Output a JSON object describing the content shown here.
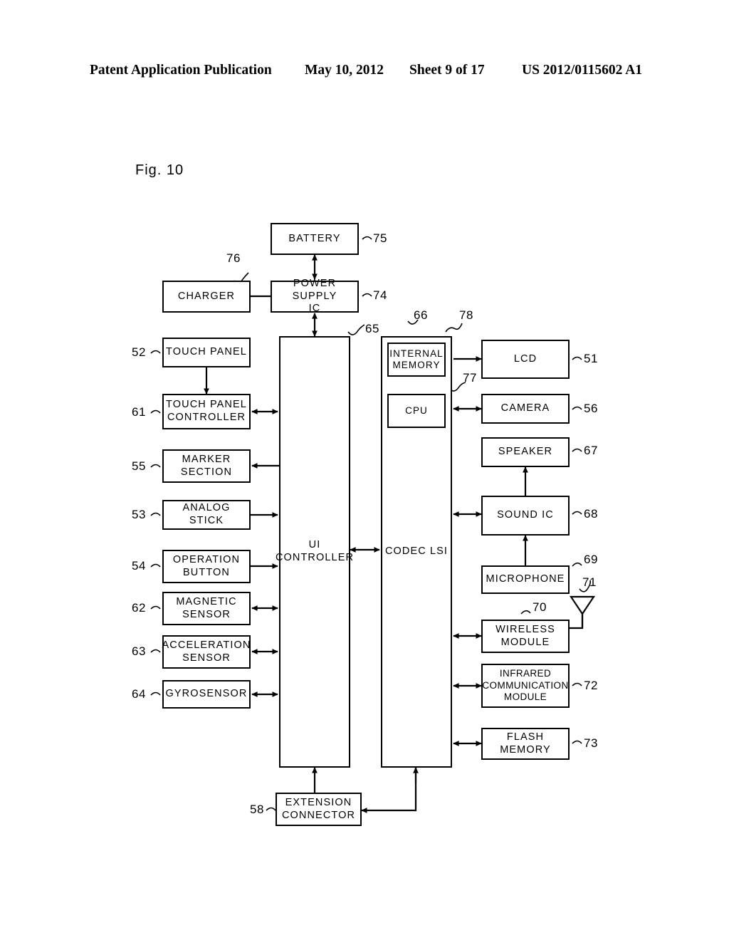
{
  "header": {
    "publication": "Patent Application Publication",
    "date": "May 10, 2012",
    "sheet": "Sheet 9 of 17",
    "patent_number": "US 2012/0115602 A1"
  },
  "figure": {
    "label": "Fig. 10",
    "type": "block-diagram",
    "description": "Block diagram of terminal device internal configuration"
  },
  "blocks": {
    "battery": {
      "label": "BATTERY",
      "ref": "75"
    },
    "charger": {
      "label": "CHARGER",
      "ref": "76"
    },
    "power_supply_ic": {
      "label": "POWER SUPPLY\nIC",
      "ref": "74"
    },
    "touch_panel": {
      "label": "TOUCH PANEL",
      "ref": "52"
    },
    "touch_panel_controller": {
      "label": "TOUCH PANEL\nCONTROLLER",
      "ref": "61"
    },
    "marker_section": {
      "label": "MARKER\nSECTION",
      "ref": "55"
    },
    "analog_stick": {
      "label": "ANALOG STICK",
      "ref": "53"
    },
    "operation_button": {
      "label": "OPERATION\nBUTTON",
      "ref": "54"
    },
    "magnetic_sensor": {
      "label": "MAGNETIC\nSENSOR",
      "ref": "62"
    },
    "acceleration_sensor": {
      "label": "ACCELERATION\nSENSOR",
      "ref": "63"
    },
    "gyrosensor": {
      "label": "GYROSENSOR",
      "ref": "64"
    },
    "ui_controller": {
      "label": "UI\nCONTROLLER",
      "ref": "65"
    },
    "codec_lsi": {
      "label": "CODEC LSI",
      "ref": "66"
    },
    "internal_memory": {
      "label": "INTERNAL\nMEMORY",
      "ref": "78"
    },
    "cpu": {
      "label": "CPU",
      "ref": "77"
    },
    "lcd": {
      "label": "LCD",
      "ref": "51"
    },
    "camera": {
      "label": "CAMERA",
      "ref": "56"
    },
    "speaker": {
      "label": "SPEAKER",
      "ref": "67"
    },
    "sound_ic": {
      "label": "SOUND IC",
      "ref": "68"
    },
    "microphone": {
      "label": "MICROPHONE",
      "ref": "69"
    },
    "wireless_module": {
      "label": "WIRELESS\nMODULE",
      "ref": "70"
    },
    "antenna": {
      "label": "",
      "ref": "71"
    },
    "infrared_communication_module": {
      "label": "INFRARED\nCOMMUNICATION\nMODULE",
      "ref": "72"
    },
    "flash_memory": {
      "label": "FLASH MEMORY",
      "ref": "73"
    },
    "extension_connector": {
      "label": "EXTENSION\nCONNECTOR",
      "ref": "58"
    }
  }
}
